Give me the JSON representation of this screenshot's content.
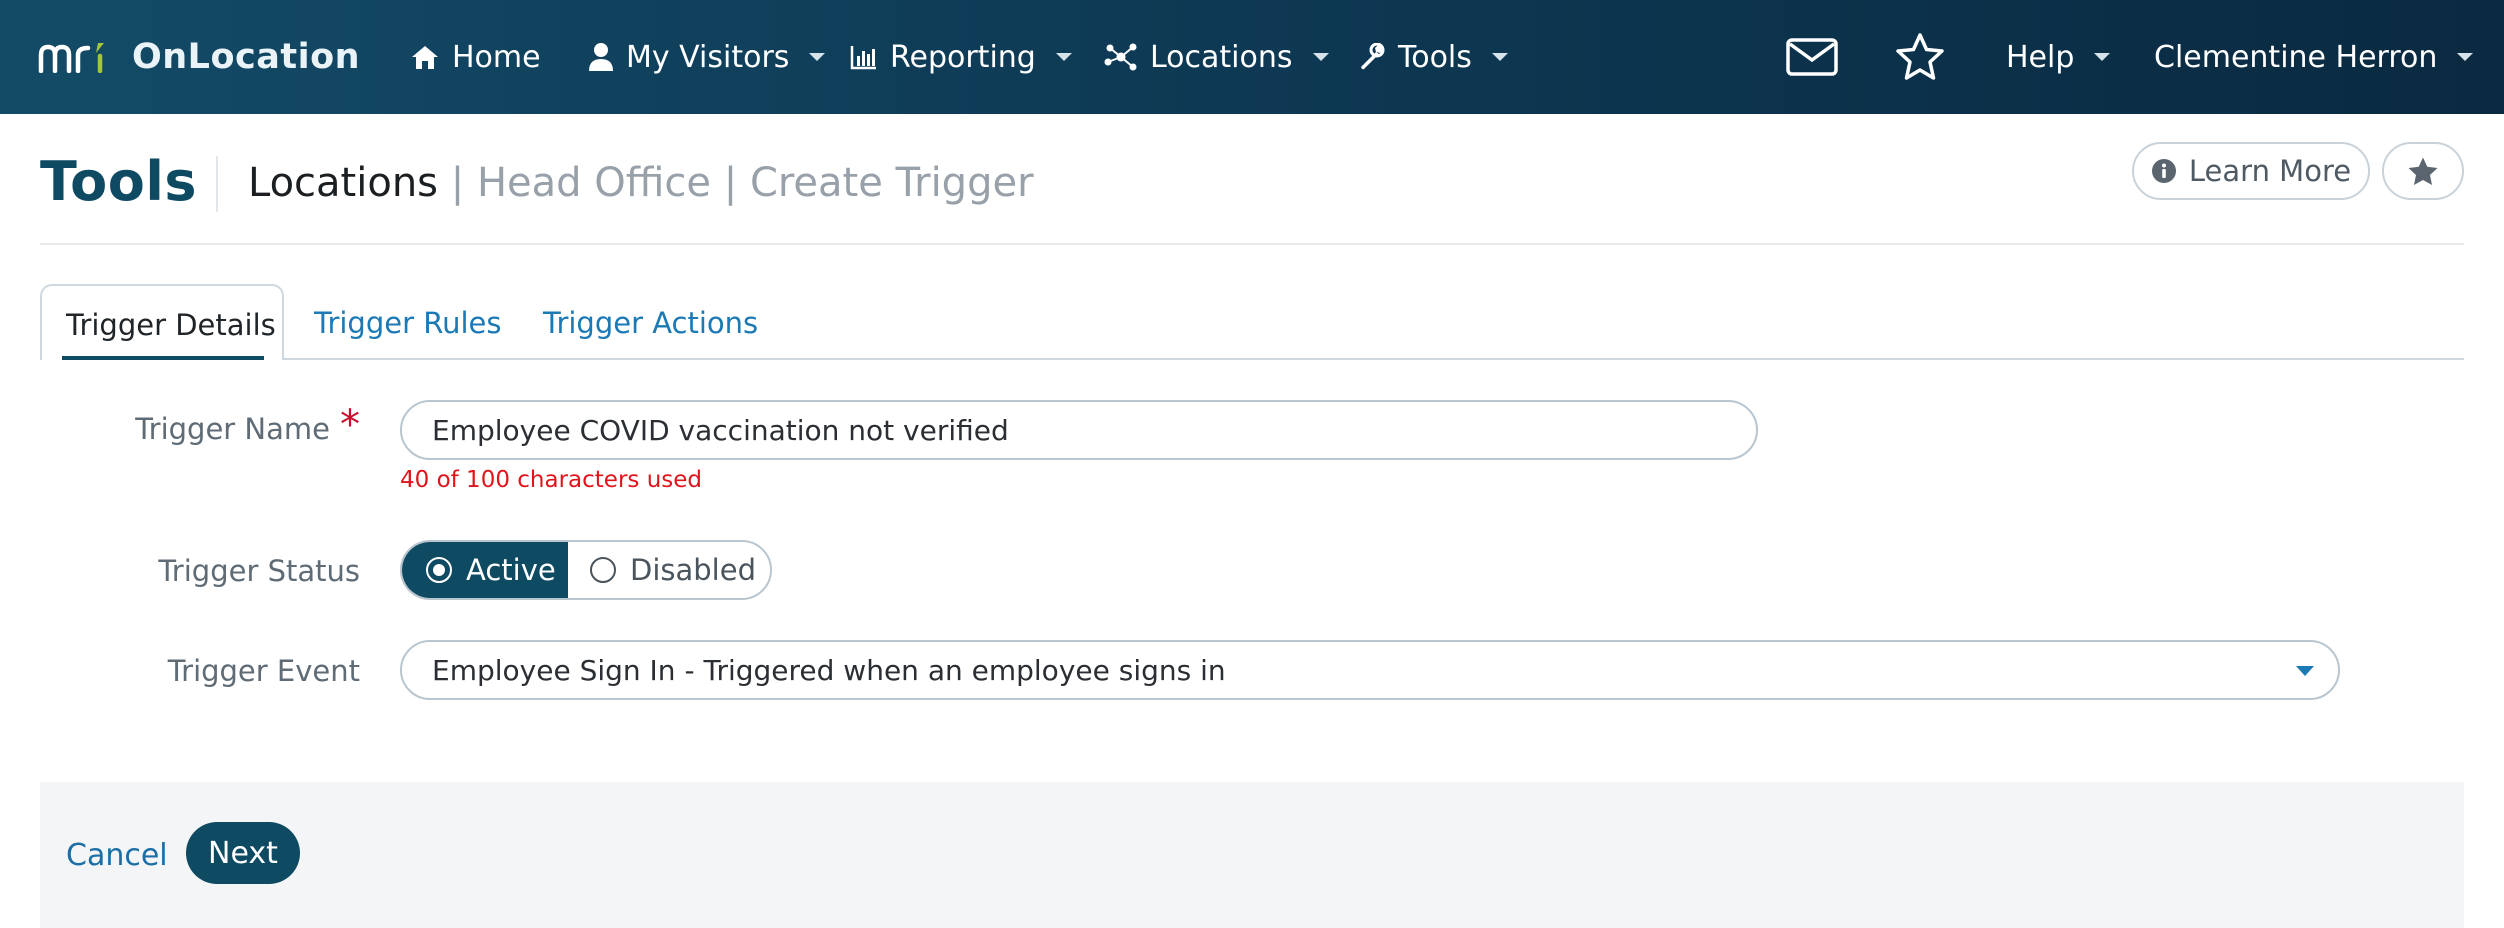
{
  "colors": {
    "nav_bg": "#0e3a55",
    "brand_dark": "#0f4a63",
    "link": "#1b79b5",
    "error": "#e0141b",
    "required": "#c8102e"
  },
  "nav": {
    "brand": "OnLocation",
    "logo_icon": "mri-logo",
    "items": [
      {
        "label": "Home",
        "icon": "home-icon"
      },
      {
        "label": "My Visitors",
        "icon": "user-icon"
      },
      {
        "label": "Reporting",
        "icon": "bar-chart-icon"
      },
      {
        "label": "Locations",
        "icon": "network-icon"
      },
      {
        "label": "Tools",
        "icon": "wrench-icon"
      }
    ],
    "mail_icon": "envelope-icon",
    "favorites_icon": "star-outline-icon",
    "help": "Help",
    "user": "Clementine Herron"
  },
  "header": {
    "title": "Tools",
    "breadcrumb": [
      "Locations",
      "Head Office",
      "Create Trigger"
    ],
    "separator": "|",
    "learn_more": "Learn More",
    "learn_more_icon": "info-circle-icon",
    "favorite_icon": "star-solid-icon"
  },
  "tabs": [
    {
      "label": "Trigger Details",
      "active": true
    },
    {
      "label": "Trigger Rules",
      "active": false
    },
    {
      "label": "Trigger Actions",
      "active": false
    }
  ],
  "form": {
    "name": {
      "label": "Trigger Name",
      "required_mark": "*",
      "value": "Employee COVID vaccination not verified",
      "counter": "40 of 100 characters used"
    },
    "status": {
      "label": "Trigger Status",
      "options": [
        "Active",
        "Disabled"
      ],
      "selected": "Active"
    },
    "event": {
      "label": "Trigger Event",
      "value": "Employee Sign In - Triggered when an employee signs in"
    }
  },
  "footer": {
    "cancel": "Cancel",
    "next": "Next"
  }
}
